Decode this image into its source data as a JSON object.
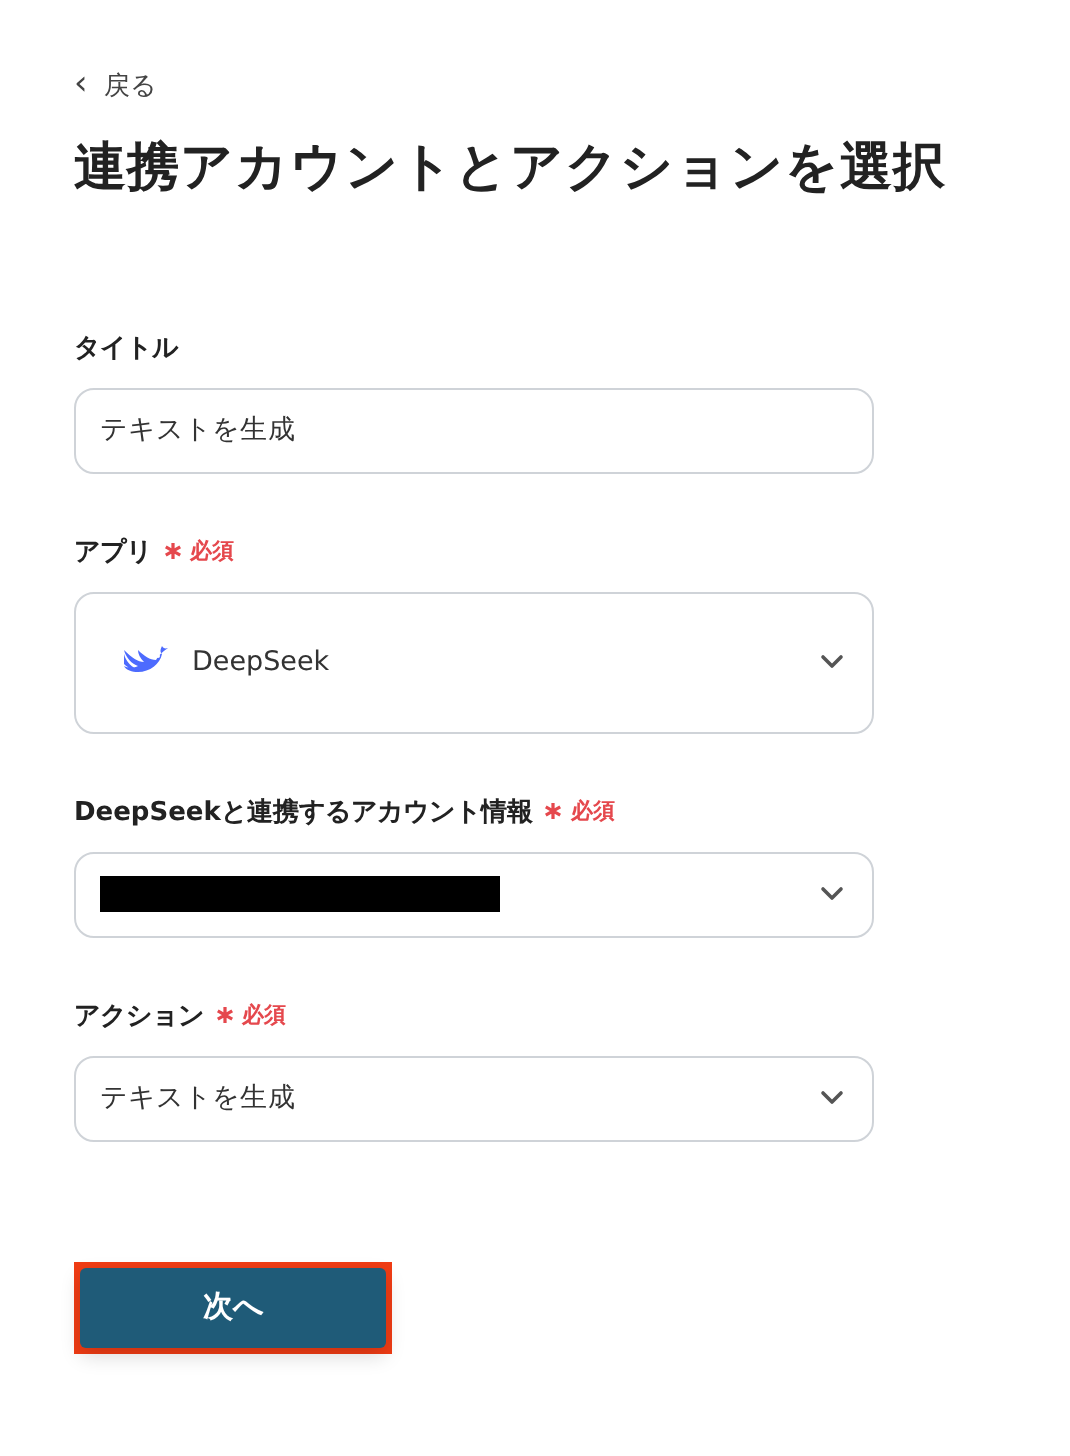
{
  "back_link": {
    "icon": "‹",
    "label": "戻る"
  },
  "heading": "連携アカウントとアクションを選択",
  "fields": [
    {
      "kind": "text",
      "label": "タイトル",
      "required": false,
      "value": "テキストを生成"
    },
    {
      "kind": "app-select",
      "label": "アプリ",
      "required": true,
      "required_label": "必須",
      "value": "DeepSeek"
    },
    {
      "kind": "redacted-select",
      "label": "DeepSeekと連携するアカウント情報",
      "required": true,
      "required_label": "必須"
    },
    {
      "kind": "select",
      "label": "アクション",
      "required": true,
      "required_label": "必須",
      "value": "テキストを生成"
    }
  ],
  "next_button": {
    "label": "次へ",
    "highlighted": true
  }
}
